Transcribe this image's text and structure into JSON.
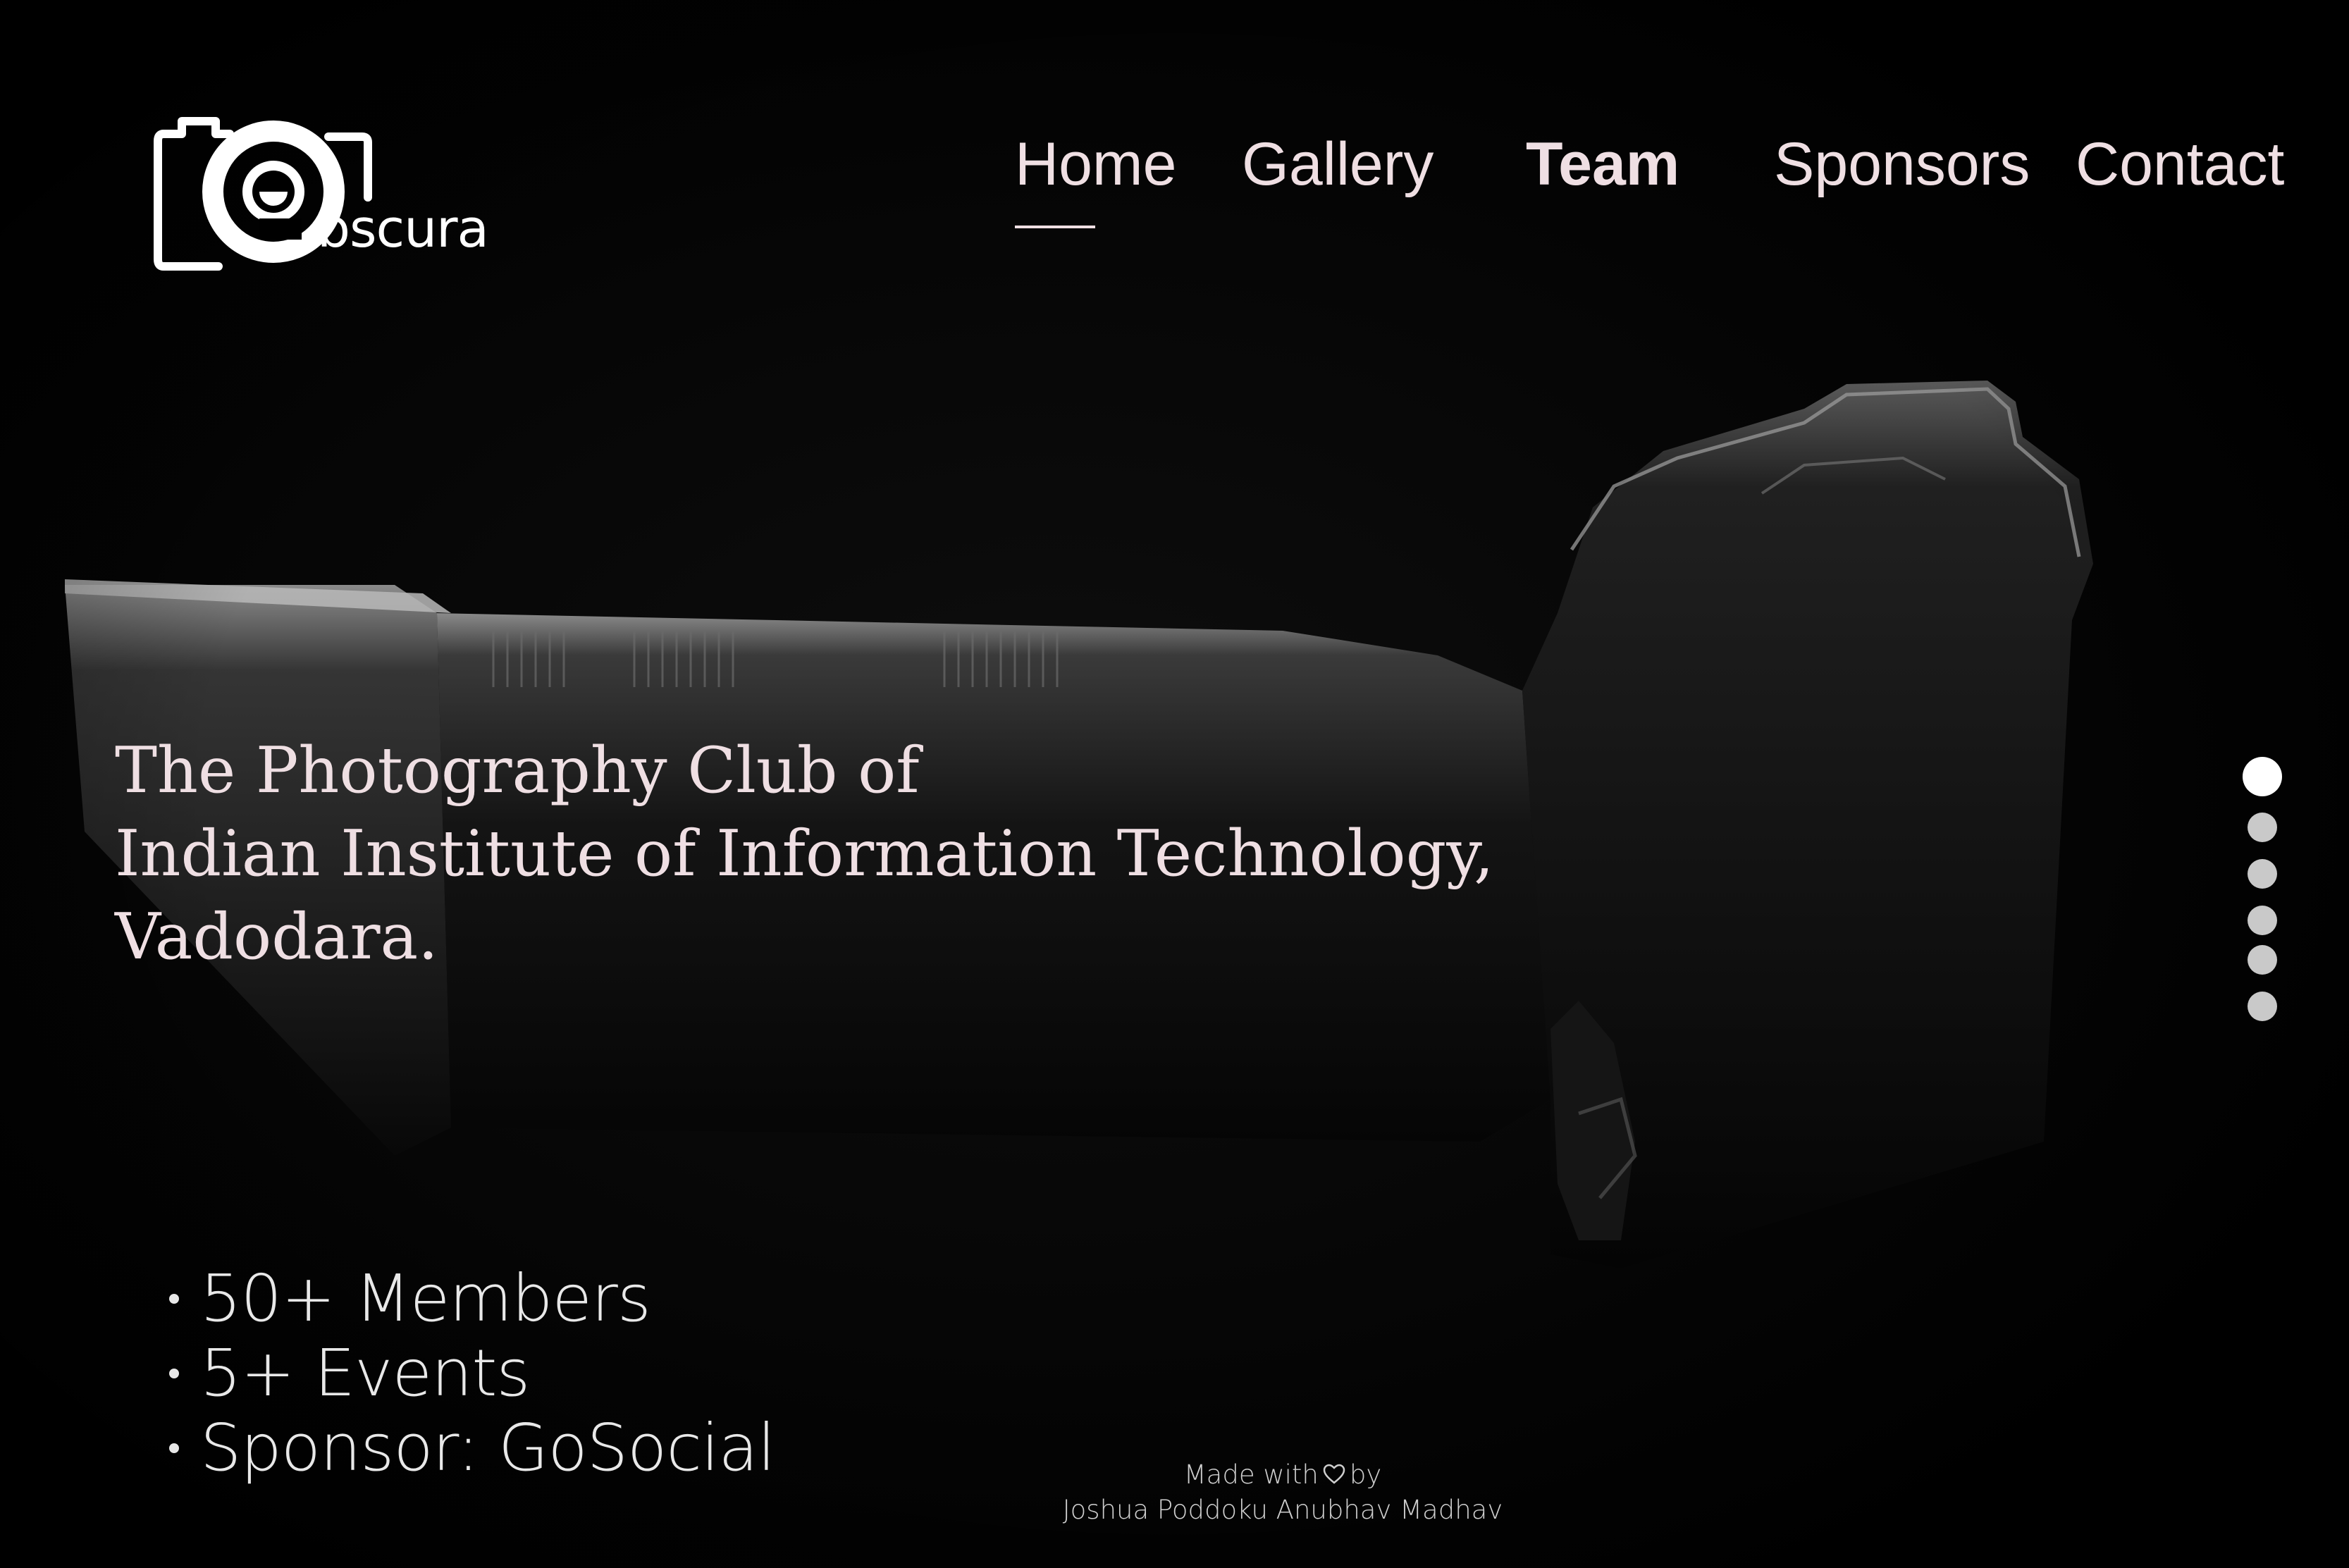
{
  "brand": {
    "logo_text": "bscura"
  },
  "nav": {
    "items": [
      {
        "label": "Home",
        "active": true
      },
      {
        "label": "Gallery"
      },
      {
        "label": "Team"
      },
      {
        "label": "Sponsors"
      },
      {
        "label": "Contact"
      }
    ]
  },
  "hero": {
    "headline_lines": [
      "The Photography Club of",
      "Indian Institute of Information Technology,",
      "Vadodara."
    ]
  },
  "stats": [
    "50+ Members",
    "5+ Events",
    "Sponsor: GoSocial"
  ],
  "slider": {
    "total": 6,
    "active_index": 0
  },
  "footer": {
    "made_with_prefix": "Made with",
    "made_with_suffix": "by",
    "authors": "Joshua Poddoku  Anubhav Madhav",
    "heart_icon": "heart-icon"
  },
  "colors": {
    "background": "#000000",
    "nav_text": "#efdfe3",
    "headline": "#efdfe3",
    "dot_inactive": "#c9c9c9",
    "dot_active": "#ffffff"
  }
}
